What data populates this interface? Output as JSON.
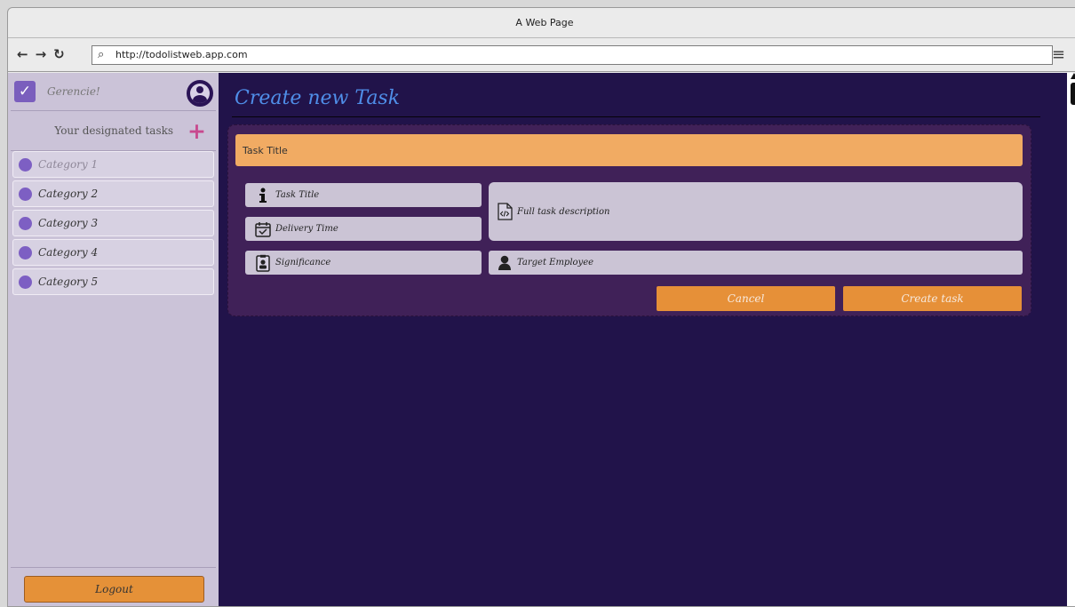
{
  "browser": {
    "title": "A Web Page",
    "url": "http://todolistweb.app.com"
  },
  "sidebar": {
    "brand": "Gerencie!",
    "subtitle": "Your designated tasks",
    "categories": [
      {
        "label": "Category 1"
      },
      {
        "label": "Category 2"
      },
      {
        "label": "Category 3"
      },
      {
        "label": "Category 4"
      },
      {
        "label": "Category 5"
      }
    ],
    "logout_label": "Logout",
    "colors": {
      "category_dot": "#7d5fc3",
      "plus": "#c8498e"
    }
  },
  "main": {
    "title": "Create new Task",
    "form": {
      "title_value": "Task Title",
      "task_title_label": "Task Title",
      "delivery_label": "Delivery Time",
      "significance_label": "Significance",
      "description_label": "Full task description",
      "employee_label": "Target Employee",
      "cancel_label": "Cancel",
      "create_label": "Create task"
    }
  },
  "colors": {
    "accent_orange": "#e69038",
    "main_bg": "#21134a",
    "card_bg": "#402158",
    "title_blue": "#4f8ee8"
  }
}
